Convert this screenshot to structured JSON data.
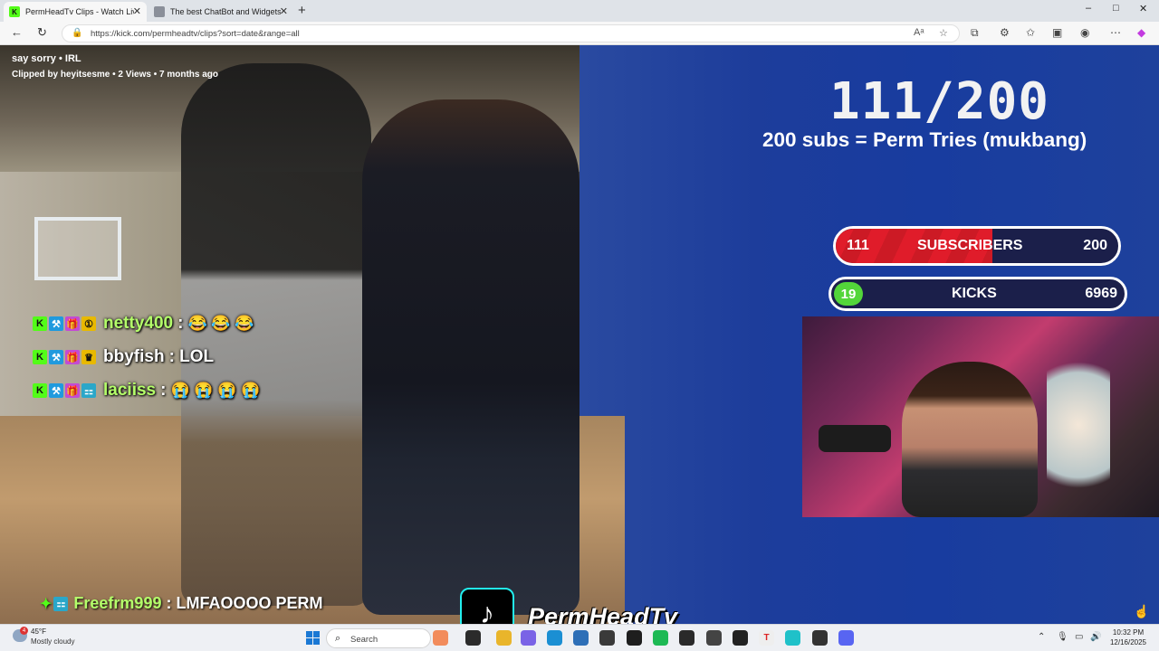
{
  "browser": {
    "tabs": [
      {
        "title": "PermHeadTv Clips - Watch Live o",
        "active": true,
        "favicon_text": "K"
      },
      {
        "title": "The best ChatBot and Widgets fo",
        "active": false,
        "favicon_text": ""
      }
    ],
    "new_tab_glyph": "+",
    "close_glyph": "✕",
    "window_controls": {
      "minimize": "–",
      "maximize": "□",
      "close": "✕"
    },
    "url": "https://kick.com/permheadtv/clips?sort=date&range=all"
  },
  "clip": {
    "title": "say sorry • IRL",
    "meta": "Clipped by heyitsesme • 2 Views • 7 months ago"
  },
  "overlay": {
    "goal_count": "111/200",
    "goal_text": "200 subs = Perm Tries (mukbang)",
    "subs_bar": {
      "current": "111",
      "label": "SUBSCRIBERS",
      "target": "200",
      "progress": 0.555
    },
    "kicks_bar": {
      "current": "19",
      "label": "KICKS",
      "target": "6969",
      "progress": 0.003
    }
  },
  "chat": [
    {
      "user": "netty400",
      "color": "#b4ff6a",
      "message": ":",
      "emotes": "😂 😂 😂",
      "badges": [
        "K",
        "⚒",
        "🎁",
        "①"
      ]
    },
    {
      "user": "bbyfish",
      "color": "#ffffff",
      "message": ": LOL",
      "emotes": "",
      "badges": [
        "K",
        "⚒",
        "🎁",
        "♛"
      ]
    },
    {
      "user": "laciiss",
      "color": "#b4ff6a",
      "message": ":",
      "emotes": "😭 😭 😭 😭",
      "badges": [
        "K",
        "⚒",
        "🎁",
        "⚏"
      ]
    }
  ],
  "bottom_chat": {
    "user": "Freefrm999",
    "message": ": LMFAOOOO PERM"
  },
  "brand": {
    "name": "PermHeadTv",
    "logo_glyph": "♪"
  },
  "taskbar": {
    "weather": {
      "temp": "45°F",
      "condition": "Mostly cloudy",
      "badge": "4"
    },
    "search_placeholder": "Search",
    "time": "10:32 PM",
    "date": "12/16/2025"
  },
  "colors": {
    "kick_green": "#53fc18",
    "subs_red": "#e01c2a",
    "wall_blue": "#1d3d9b",
    "bar_bg": "#1b1f4a"
  }
}
